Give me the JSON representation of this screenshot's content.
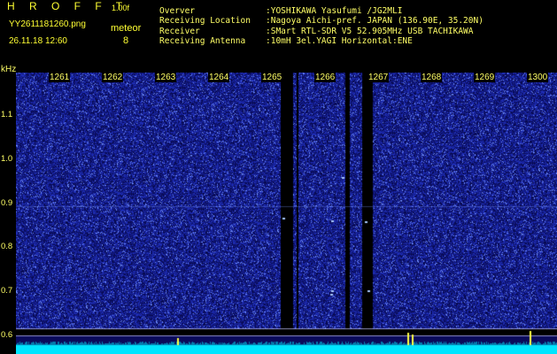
{
  "header": {
    "app_title": "H R O F F T",
    "version": "1.00f",
    "filename": "YY2611181260.png",
    "datetime": "26.11.18 12:60",
    "mode_label": "meteor",
    "count": "8"
  },
  "station_info": [
    {
      "label": "Overver",
      "value": ":YOSHIKAWA Yasufumi /JG2MLI"
    },
    {
      "label": "Receiving Location",
      "value": ":Nagoya Aichi-pref. JAPAN (136.90E, 35.20N)"
    },
    {
      "label": "Receiver",
      "value": ":SMart RTL-SDR V5 52.905MHz USB TACHIKAWA"
    },
    {
      "label": "Receiving Antenna",
      "value": ":10mH 3el.YAGI Horizontal:ENE"
    }
  ],
  "spectrogram": {
    "y_unit": "kHz",
    "y_ticks": [
      "1.1",
      "1.0",
      "0.9",
      "0.8",
      "0.7",
      "0.6"
    ],
    "x_ticks": [
      "1261",
      "1262",
      "1263",
      "1264",
      "1265",
      "1266",
      "1267",
      "1268",
      "1269",
      "1300"
    ],
    "colors": {
      "background": "#0a0a5a",
      "noise": "#2a3ab8",
      "signal": "#88aaff",
      "dropout": "#000000",
      "baseline": "#00e5ff",
      "label": "#ffff66"
    }
  }
}
